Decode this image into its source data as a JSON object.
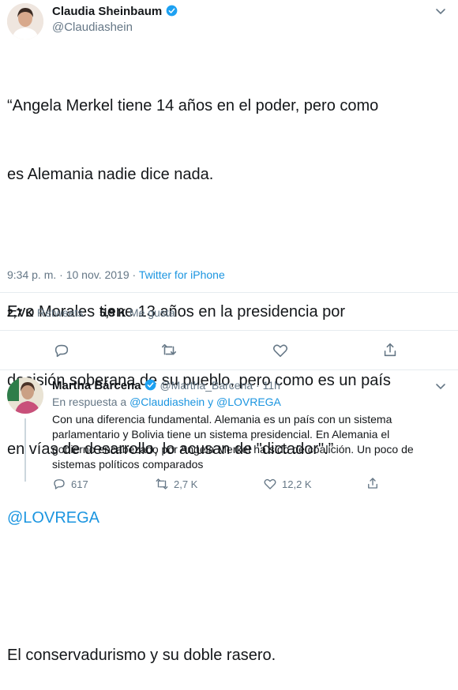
{
  "main_tweet": {
    "author_name": "Claudia Sheinbaum",
    "author_handle": "@Claudiashein",
    "text_line1": "“Angela Merkel tiene 14 años en el poder, pero como",
    "text_line2": "es Alemania nadie dice nada.",
    "text_line3": "Evo Morales tiene 13 años en la presidencia por",
    "text_line4": "decisión soberana de su pueblo, pero como es un país",
    "text_line5": "en vías de desarrollo, lo acusan de \"dictador\".”",
    "mention": "@LOVREGA",
    "text_line6": "El conservadurismo y su doble rasero.",
    "time": "9:34 p. m. · 10 nov. 2019 · ",
    "source": "Twitter for iPhone",
    "retweets_count": "2,7 K",
    "retweets_label": "Retweets",
    "likes_count": "5,9 K",
    "likes_label": "Me gusta"
  },
  "reply": {
    "author_name": "Martha Bárcena",
    "author_handle": "@Martha_Barcena · 11h",
    "in_reply_prefix": "En respuesta a ",
    "in_reply_users": "@Claudiashein y @LOVREGA",
    "text_line1": "Con una diferencia fundamental. Alemania es un país con un sistema",
    "text_line2": "parlamentario y Bolivia tiene un sistema presidencial. En Alemania el",
    "text_line3": "gobierno encabezado por Angela Merkel ha sido de coalición. Un poco de",
    "text_line4": "sistemas políticos comparados",
    "reply_count": "617",
    "retweet_count": "2,7 K",
    "like_count": "12,2 K"
  },
  "colors": {
    "accent": "#1b95e0",
    "muted": "#657786",
    "divider": "#e6ecf0"
  }
}
